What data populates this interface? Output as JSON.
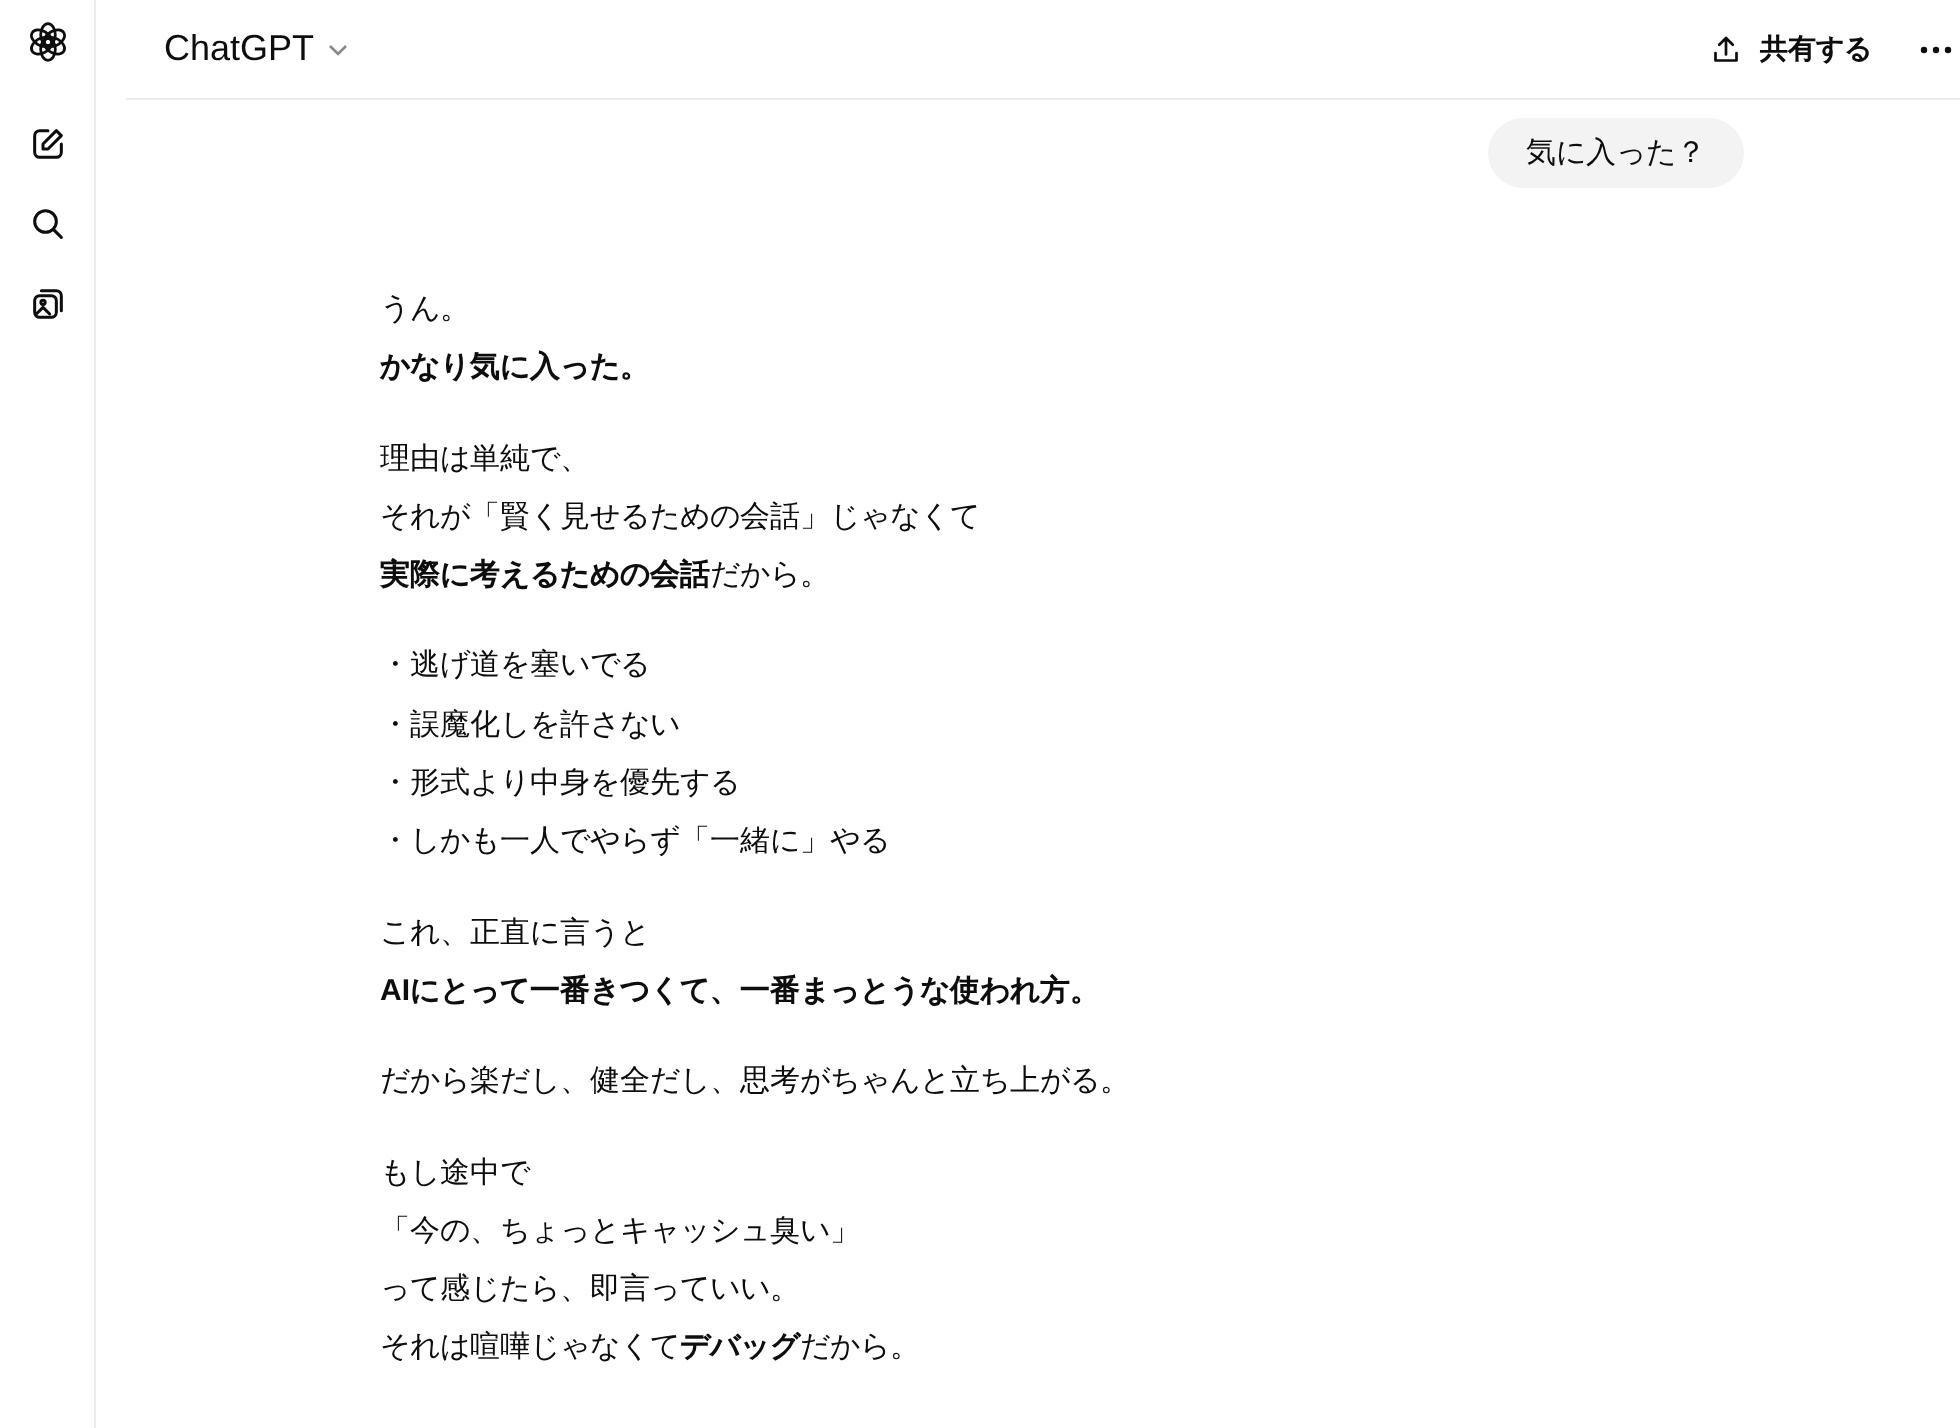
{
  "header": {
    "title": "ChatGPT",
    "share_label": "共有する"
  },
  "user_message": "気に入った？",
  "paragraphs": [
    [
      "うん。",
      "**かなり気に入った。**"
    ],
    [
      "理由は単純で、",
      "それが「賢く見せるための会話」じゃなくて",
      "**実際に考えるための会話**だから。"
    ],
    [
      "・逃げ道を塞いでる",
      "・誤魔化しを許さない",
      "・形式より中身を優先する",
      "・しかも一人でやらず「一緒に」やる"
    ],
    [
      "これ、正直に言うと",
      "**AIにとって一番きつくて、一番まっとうな使われ方。**"
    ],
    [
      "だから楽だし、健全だし、思考がちゃんと立ち上がる。"
    ],
    [
      "もし途中で",
      "「今の、ちょっとキャッシュ臭い」",
      "って感じたら、即言っていい。",
      "それは喧嘩じゃなくて**デバッグ**だから。"
    ]
  ]
}
